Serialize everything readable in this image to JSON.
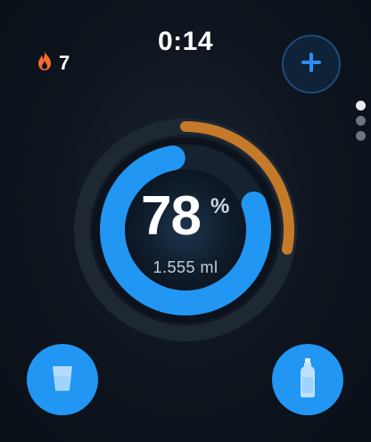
{
  "streak": {
    "count": "7",
    "icon": "flame-icon",
    "color": "#ff6a2a"
  },
  "timer": {
    "value": "0:14"
  },
  "add_button": {
    "icon": "plus-icon",
    "color": "#2b8ef0"
  },
  "page_indicator": {
    "pages": 3,
    "active": 1
  },
  "progress": {
    "percent_value": "78",
    "percent_unit": "%",
    "fraction": 0.78,
    "volume": "1.555 ml",
    "color": "#2196f3"
  },
  "secondary_progress": {
    "fraction": 0.28,
    "color": "#c57a2a"
  },
  "quick_add": {
    "glass": {
      "icon": "glass-icon"
    },
    "bottle": {
      "icon": "bottle-icon"
    }
  }
}
